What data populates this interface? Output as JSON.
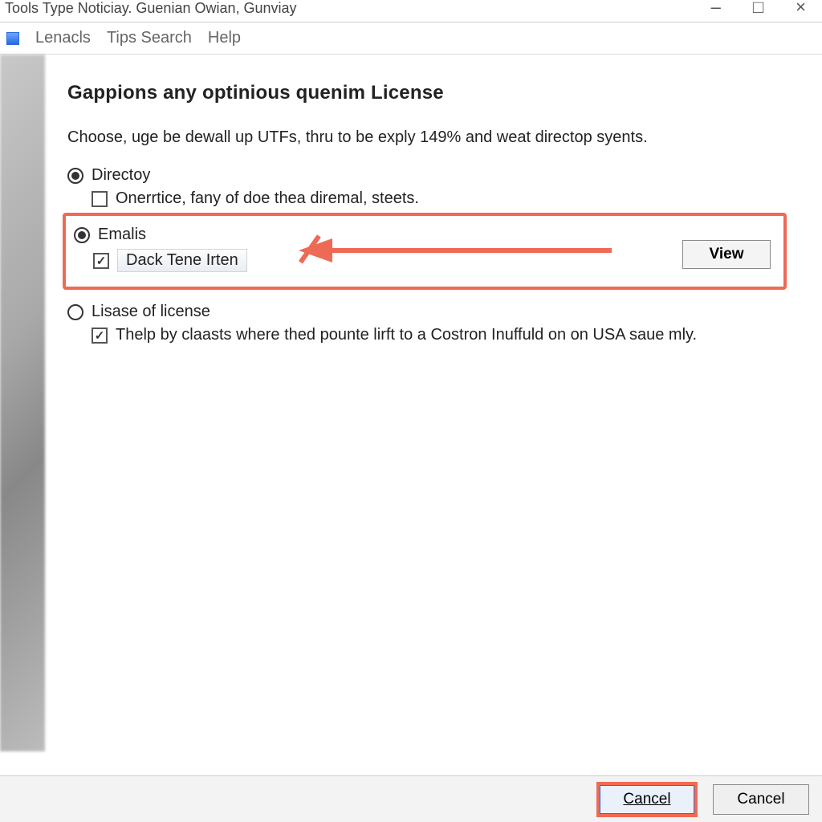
{
  "window": {
    "title": "Tools Type Noticiay. Guenian Owian, Gunviay"
  },
  "menubar": {
    "items": [
      "Lenacls",
      "Tips Search",
      "Help"
    ]
  },
  "page": {
    "heading": "Gappions any optinious quenim License",
    "intro": "Choose, uge be dewall up UTFs, thru to be exply 149% and weat directop syents."
  },
  "options": {
    "radio_directoy": {
      "label": "Directoy",
      "selected": true
    },
    "check_onerrtice": {
      "label": "Onerrtice, fany of doe thea diremal, steets.",
      "checked": false
    },
    "radio_emalis": {
      "label": "Emalis",
      "selected": true
    },
    "check_dack": {
      "label": "Dack Tene Irten",
      "checked": true
    },
    "view_button": "View",
    "radio_lisase": {
      "label": "Lisase of license",
      "selected": false
    },
    "check_thelp": {
      "label": "Thelp by claasts where thed pounte lirft to a Costron Inuffuld on on USA saue mly.",
      "checked": true
    }
  },
  "footer": {
    "primary": "Cancel",
    "secondary": "Cancel"
  },
  "annotation": {
    "color": "#ef6a56"
  }
}
